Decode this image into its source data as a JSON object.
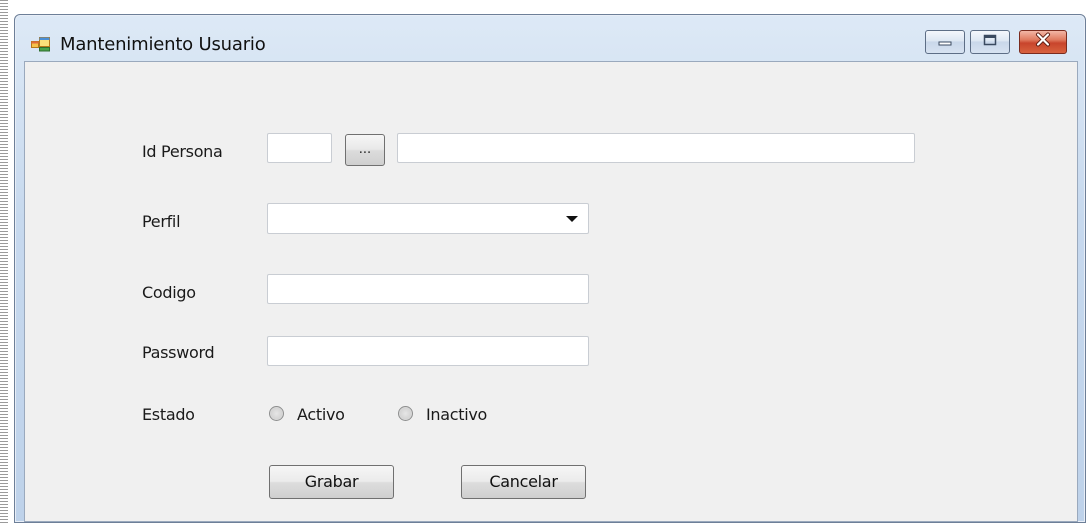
{
  "window": {
    "title": "Mantenimiento Usuario",
    "icon": "app-form-icon",
    "controls": [
      "minimize-icon",
      "maximize-icon",
      "close-icon"
    ]
  },
  "form": {
    "id_persona": {
      "label": "Id Persona",
      "id_value": "",
      "browse_label": "...",
      "name_value": ""
    },
    "perfil": {
      "label": "Perfil",
      "selected": ""
    },
    "codigo": {
      "label": "Codigo",
      "value": ""
    },
    "password": {
      "label": "Password",
      "value": ""
    },
    "estado": {
      "label": "Estado",
      "options": [
        {
          "label": "Activo",
          "checked": false
        },
        {
          "label": "Inactivo",
          "checked": false
        }
      ]
    },
    "buttons": {
      "save": "Grabar",
      "cancel": "Cancelar"
    }
  },
  "colors": {
    "titlebar": "#c7d9ee",
    "client_background": "#f0f0f0",
    "close_button": "#c8452c"
  }
}
